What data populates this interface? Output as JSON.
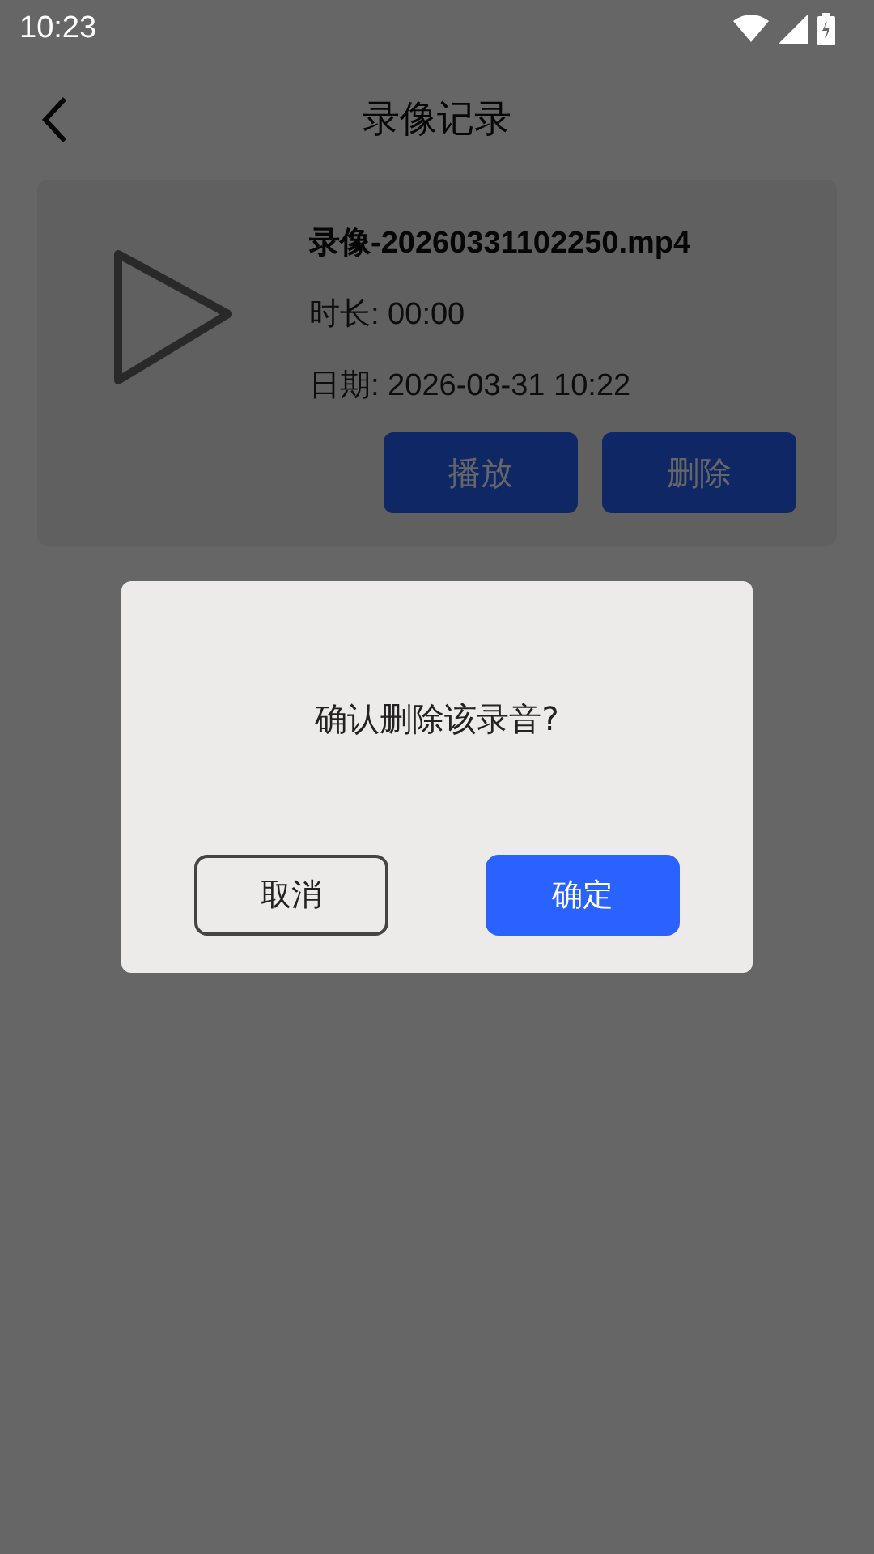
{
  "status_bar": {
    "time": "10:23"
  },
  "header": {
    "title": "录像记录"
  },
  "recordings": [
    {
      "name": "录像-20260331102250.mp4",
      "duration": "时长: 00:00",
      "date": "日期: 2026-03-31 10:22",
      "buttons": [
        "播放",
        "删除"
      ]
    }
  ],
  "dialog": {
    "message": "确认删除该录音?",
    "buttons": [
      {
        "label": "取消",
        "kind": "secondary"
      },
      {
        "label": "确定",
        "kind": "primary"
      }
    ]
  }
}
